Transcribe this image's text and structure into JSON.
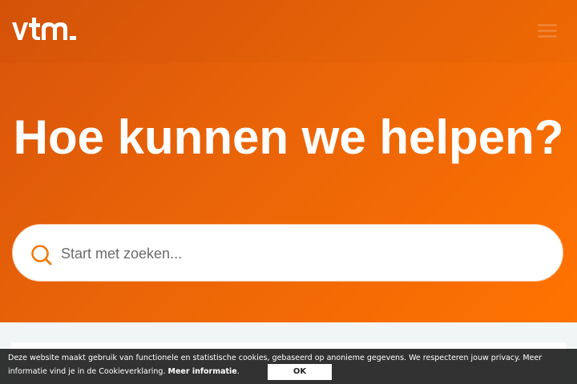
{
  "header": {
    "logo_text": "vtm",
    "logo_icon": "vtm-logo-icon",
    "menu_icon": "hamburger-menu-icon"
  },
  "hero": {
    "title": "Hoe kunnen we helpen?"
  },
  "search": {
    "placeholder": "Start met zoeken...",
    "value": "",
    "icon": "search-icon"
  },
  "cookie_banner": {
    "text": "Deze website maakt gebruik van functionele en statistische cookies, gebaseerd op anonieme gegevens. We respecteren jouw privacy. Meer informatie vind je in de Cookieverklaring.",
    "more_label": "Meer informatie",
    "trailing": ".",
    "ok_label": "OK"
  },
  "colors": {
    "brand_orange": "#ff7300",
    "brand_orange_dark": "#d8540a",
    "cookie_bg": "#222222"
  }
}
